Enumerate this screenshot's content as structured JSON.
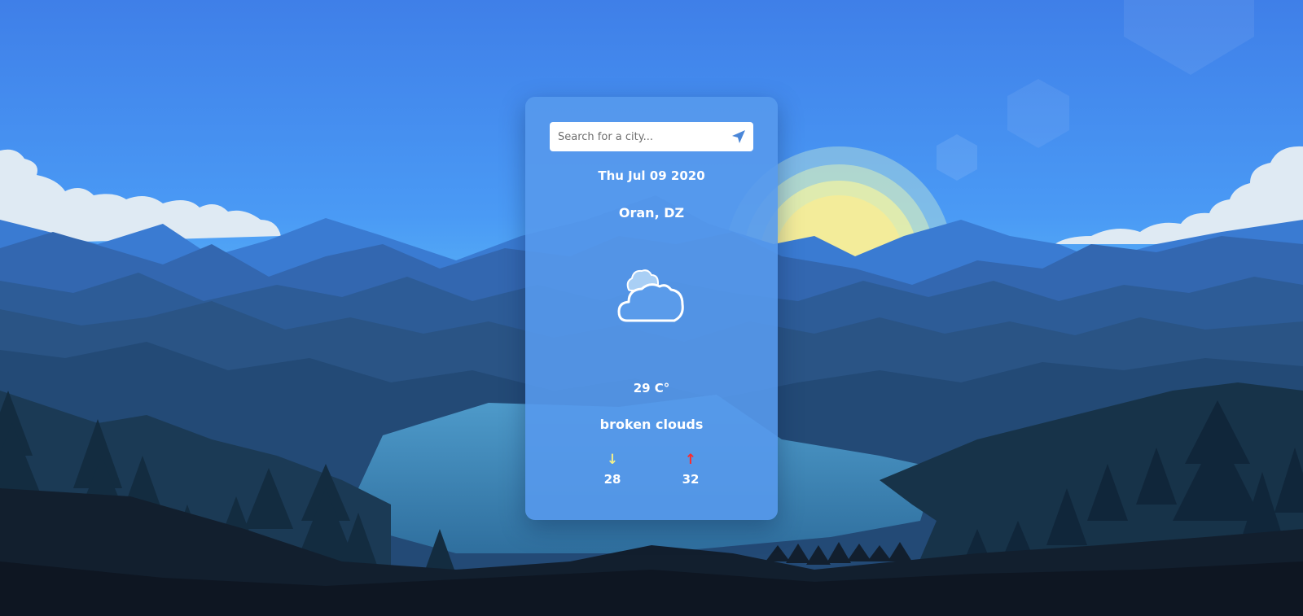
{
  "colors": {
    "sky_top": "#3f86ee",
    "sky_bottom": "#7fd8f2",
    "sun": "#f3ec9a",
    "card_bg": "#5699ec",
    "min_arrow": "#f3f08a",
    "max_arrow": "#ff2a2a"
  },
  "search": {
    "placeholder": "Search for a city...",
    "value": "",
    "button_icon": "send-icon"
  },
  "weather": {
    "date": "Thu Jul 09 2020",
    "city": "Oran, DZ",
    "icon": "broken-clouds-icon",
    "temperature": "29 C°",
    "description": "broken clouds",
    "min_icon": "arrow-down-icon",
    "max_icon": "arrow-up-icon",
    "min": "28",
    "max": "32"
  }
}
